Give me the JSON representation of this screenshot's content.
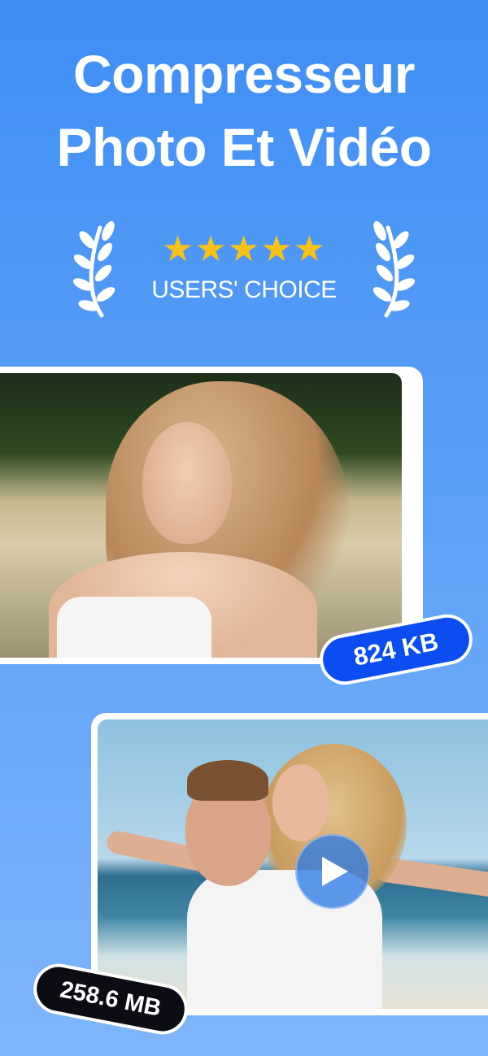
{
  "headline": {
    "line1": "Compresseur",
    "line2": "Photo Et Vidéo"
  },
  "award": {
    "stars": "★★★★★",
    "star_count": 5,
    "label": "USERS' CHOICE",
    "star_color": "#f7c21a"
  },
  "cards": [
    {
      "type": "photo",
      "size_label": "824 KB",
      "badge_color": "#0b4df0"
    },
    {
      "type": "video",
      "size_label": "258.6 MB",
      "badge_color": "#0c0c14",
      "icon": "play-icon"
    }
  ],
  "colors": {
    "background_top": "#3f8ef5",
    "background_bottom": "#7fb6fb",
    "text": "#ffffff"
  }
}
